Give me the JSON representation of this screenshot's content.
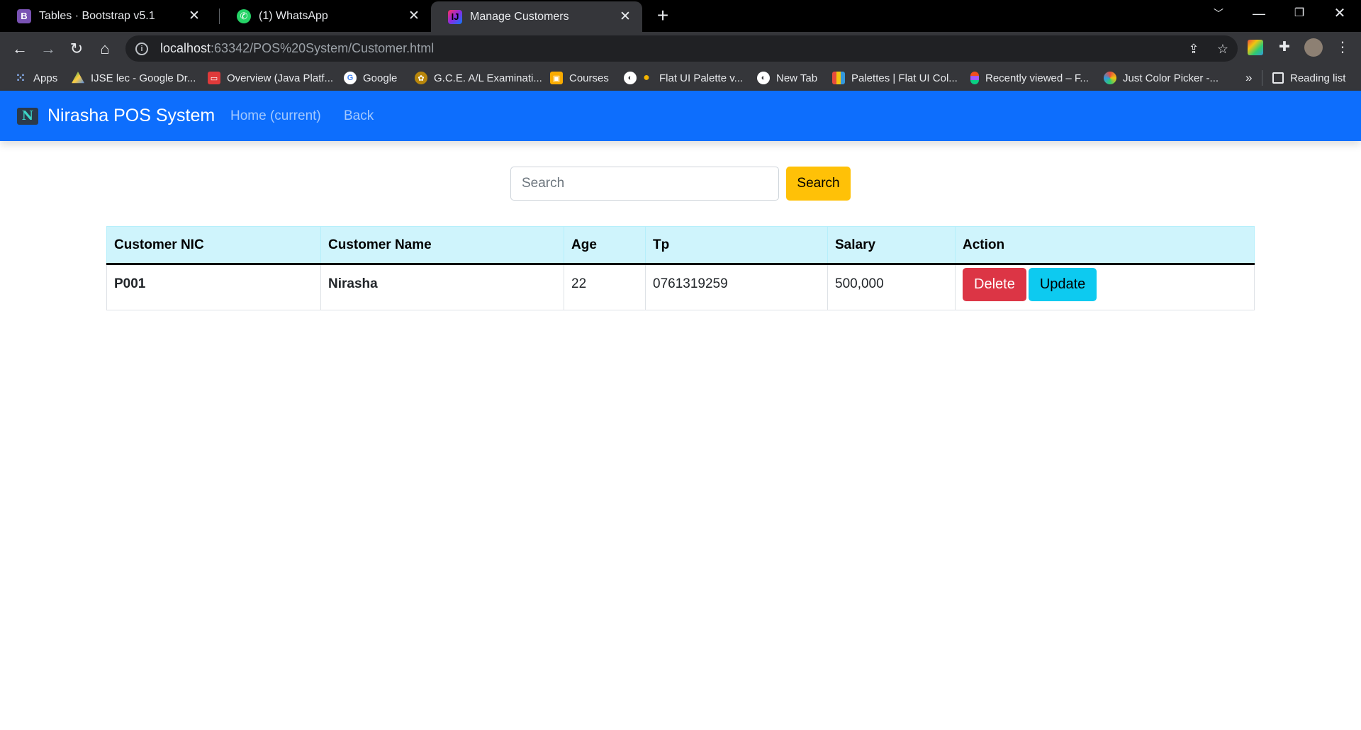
{
  "browser": {
    "tabs": [
      {
        "title": "Tables · Bootstrap v5.1",
        "favicon": "bootstrap-icon",
        "active": false
      },
      {
        "title": "(1) WhatsApp",
        "favicon": "whatsapp-icon",
        "active": false
      },
      {
        "title": "Manage Customers",
        "favicon": "intellij-icon",
        "active": true
      }
    ],
    "url_host": "localhost",
    "url_rest": ":63342/POS%20System/Customer.html",
    "bookmarks": [
      {
        "label": "Apps",
        "icon": "apps-grid-icon"
      },
      {
        "label": "IJSE lec - Google Dr...",
        "icon": "google-drive-icon"
      },
      {
        "label": "Overview (Java Platf...",
        "icon": "oracle-icon"
      },
      {
        "label": "Google",
        "icon": "google-icon"
      },
      {
        "label": "G.C.E. A/L Examinati...",
        "icon": "emblem-icon"
      },
      {
        "label": "Courses",
        "icon": "classroom-icon"
      },
      {
        "label": "Flat UI Palette v...",
        "icon": "globe-icon"
      },
      {
        "label": "New Tab",
        "icon": "globe-icon"
      },
      {
        "label": "Palettes | Flat UI Col...",
        "icon": "palette-icon"
      },
      {
        "label": "Recently viewed – F...",
        "icon": "figma-icon"
      },
      {
        "label": "Just Color Picker -...",
        "icon": "color-picker-icon"
      }
    ],
    "bookmarks_overflow": "»",
    "reading_list": "Reading list"
  },
  "navbar": {
    "brand": "Nirasha POS System",
    "logo_letter": "N",
    "links": [
      "Home (current)",
      "Back"
    ]
  },
  "search": {
    "placeholder": "Search",
    "button_label": "Search"
  },
  "table": {
    "columns": [
      "Customer NIC",
      "Customer Name",
      "Age",
      "Tp",
      "Salary",
      "Action"
    ],
    "rows": [
      {
        "nic": "P001",
        "name": "Nirasha",
        "age": "22",
        "tp": "0761319259",
        "salary": "500,000"
      }
    ],
    "delete_label": "Delete",
    "update_label": "Update"
  },
  "colors": {
    "navbar": "#0d6efd",
    "table_head": "#cff4fc",
    "search_button": "#ffc107",
    "delete_button": "#dc3545",
    "update_button": "#0dcaf0"
  }
}
